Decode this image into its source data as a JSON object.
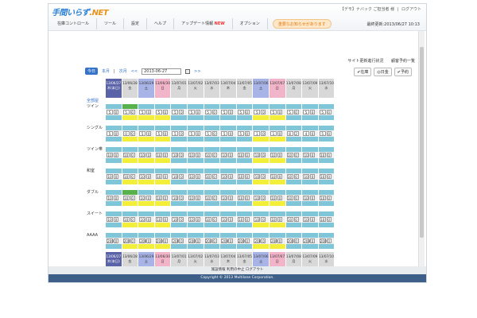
{
  "app": {
    "logo_main": "手間いらず",
    "logo_suffix": ".NET",
    "top_links": [
      "【デモ】ナバック ご担当者 様",
      "|",
      "ログアウト"
    ],
    "menu": [
      "在庫コントロール",
      "ツール",
      "設定",
      "ヘルプ",
      "アップデート情報"
    ],
    "menu_new": "NEW",
    "menu_option": "オプション",
    "menu_info": "重要なお知らせがあります",
    "datetime": "最終更新:2013/06/27 10:13",
    "links": [
      "サイト更新進行状況",
      "顧客予約一覧"
    ]
  },
  "nav": {
    "today_label": "今日",
    "this_month": "本月",
    "next_month": "次月",
    "prev_arrow": "<<",
    "next_arrow": ">>",
    "date_value": "2013-06-27"
  },
  "legend": [
    "✔在庫",
    "◎日金",
    "✔予約"
  ],
  "all_rooms": "全部屋",
  "days": [
    {
      "date": "13/06/27",
      "dow": "木(本日)",
      "type": "today"
    },
    {
      "date": "13/06/28",
      "dow": "金",
      "type": "normal"
    },
    {
      "date": "13/06/29",
      "dow": "土",
      "type": "sat"
    },
    {
      "date": "13/06/30",
      "dow": "日",
      "type": "sun"
    },
    {
      "date": "13/07/01",
      "dow": "月",
      "type": "normal"
    },
    {
      "date": "13/07/02",
      "dow": "火",
      "type": "normal"
    },
    {
      "date": "13/07/03",
      "dow": "水",
      "type": "normal"
    },
    {
      "date": "13/07/04",
      "dow": "木",
      "type": "normal"
    },
    {
      "date": "13/07/05",
      "dow": "金",
      "type": "normal"
    },
    {
      "date": "13/07/06",
      "dow": "土",
      "type": "sat"
    },
    {
      "date": "13/07/07",
      "dow": "日",
      "type": "sun"
    },
    {
      "date": "13/07/08",
      "dow": "月",
      "type": "normal"
    },
    {
      "date": "13/07/09",
      "dow": "火",
      "type": "normal"
    },
    {
      "date": "13/07/10",
      "dow": "水",
      "type": "normal"
    }
  ],
  "rooms": [
    {
      "name": "ツイン",
      "strip": [
        "#7ec6d8",
        "#57b24c",
        "#7ec6d8",
        "#7ec6d8",
        "#7ec6d8",
        "#7ec6d8",
        "#7ec6d8",
        "#7ec6d8",
        "#7ec6d8",
        "#7ec6d8",
        "#7ec6d8",
        "#7ec6d8",
        "#7ec6d8",
        "#7ec6d8"
      ],
      "strip2": [
        "#7ec6d8",
        "#f2ee3a",
        "#f2ee3a",
        "#f2ee3a",
        "#7ec6d8",
        "#7ec6d8",
        "#7ec6d8",
        "#7ec6d8",
        "#7ec6d8",
        "#f2ee3a",
        "#f2ee3a",
        "#7ec6d8",
        "#7ec6d8",
        "#7ec6d8"
      ],
      "counts": [
        [
          "5",
          "0"
        ],
        [
          "5",
          "0"
        ],
        [
          "5",
          "0"
        ],
        [
          "5",
          "0"
        ],
        [
          "5",
          "0"
        ],
        [
          "5",
          "0"
        ],
        [
          "5",
          "0"
        ],
        [
          "5",
          "0"
        ],
        [
          "5",
          "0"
        ],
        [
          "5",
          "0"
        ],
        [
          "5",
          "0"
        ],
        [
          "5",
          "0"
        ],
        [
          "5",
          "0"
        ],
        [
          "5",
          "0"
        ]
      ]
    },
    {
      "name": "シングル",
      "strip": [
        "#7ec6d8",
        "#7ec6d8",
        "#7ec6d8",
        "#7ec6d8",
        "#7ec6d8",
        "#7ec6d8",
        "#7ec6d8",
        "#7ec6d8",
        "#7ec6d8",
        "#7ec6d8",
        "#7ec6d8",
        "#7ec6d8",
        "#7ec6d8",
        "#7ec6d8"
      ],
      "strip2": [
        "#7ec6d8",
        "#f2ee3a",
        "#f2ee3a",
        "#f2ee3a",
        "#7ec6d8",
        "#7ec6d8",
        "#7ec6d8",
        "#7ec6d8",
        "#7ec6d8",
        "#f2ee3a",
        "#f2ee3a",
        "#7ec6d8",
        "#7ec6d8",
        "#7ec6d8"
      ],
      "counts": [
        [
          "5",
          "0"
        ],
        [
          "0",
          "0"
        ],
        [
          "5",
          "0"
        ],
        [
          "5",
          "0"
        ],
        [
          "5",
          "0"
        ],
        [
          "5",
          "0"
        ],
        [
          "5",
          "0"
        ],
        [
          "5",
          "0"
        ],
        [
          "5",
          "0"
        ],
        [
          "1",
          "0"
        ],
        [
          "1",
          "0"
        ],
        [
          "8",
          "2"
        ],
        [
          "4",
          "0"
        ],
        [
          "5",
          "0"
        ]
      ]
    },
    {
      "name": "ツイン帯",
      "strip": [
        "#7ec6d8",
        "#7ec6d8",
        "#7ec6d8",
        "#7ec6d8",
        "#7ec6d8",
        "#7ec6d8",
        "#7ec6d8",
        "#7ec6d8",
        "#7ec6d8",
        "#7ec6d8",
        "#7ec6d8",
        "#7ec6d8",
        "#7ec6d8",
        "#7ec6d8"
      ],
      "strip2": [
        "#7ec6d8",
        "#f2ee3a",
        "#f2ee3a",
        "#f2ee3a",
        "#7ec6d8",
        "#7ec6d8",
        "#7ec6d8",
        "#7ec6d8",
        "#7ec6d8",
        "#f2ee3a",
        "#f2ee3a",
        "#7ec6d8",
        "#7ec6d8",
        "#7ec6d8"
      ],
      "counts": [
        [
          "10",
          "0"
        ],
        [
          "10",
          "0"
        ],
        [
          "10",
          "0"
        ],
        [
          "10",
          "0"
        ],
        [
          "10",
          "0"
        ],
        [
          "10",
          "0"
        ],
        [
          "10",
          "0"
        ],
        [
          "10",
          "0"
        ],
        [
          "10",
          "0"
        ],
        [
          "10",
          "0"
        ],
        [
          "10",
          "0"
        ],
        [
          "10",
          "0"
        ],
        [
          "10",
          "0"
        ],
        [
          "10",
          "0"
        ]
      ]
    },
    {
      "name": "和室",
      "strip": [
        "#7ec6d8",
        "#7ec6d8",
        "#7ec6d8",
        "#7ec6d8",
        "#7ec6d8",
        "#7ec6d8",
        "#7ec6d8",
        "#7ec6d8",
        "#7ec6d8",
        "#7ec6d8",
        "#7ec6d8",
        "#7ec6d8",
        "#7ec6d8",
        "#7ec6d8"
      ],
      "strip2": [
        "#7ec6d8",
        "#f2ee3a",
        "#f2ee3a",
        "#f2ee3a",
        "#7ec6d8",
        "#7ec6d8",
        "#7ec6d8",
        "#7ec6d8",
        "#7ec6d8",
        "#f2ee3a",
        "#f2ee3a",
        "#7ec6d8",
        "#7ec6d8",
        "#7ec6d8"
      ],
      "counts": [
        [
          "10",
          "0"
        ],
        [
          "10",
          "0"
        ],
        [
          "10",
          "0"
        ],
        [
          "10",
          "0"
        ],
        [
          "10",
          "0"
        ],
        [
          "10",
          "0"
        ],
        [
          "10",
          "0"
        ],
        [
          "10",
          "0"
        ],
        [
          "10",
          "0"
        ],
        [
          "10",
          "0"
        ],
        [
          "10",
          "0"
        ],
        [
          "10",
          "0"
        ],
        [
          "10",
          "0"
        ],
        [
          "10",
          "0"
        ]
      ]
    },
    {
      "name": "ダブル",
      "strip": [
        "#7ec6d8",
        "#57b24c",
        "#7ec6d8",
        "#7ec6d8",
        "#7ec6d8",
        "#7ec6d8",
        "#7ec6d8",
        "#7ec6d8",
        "#7ec6d8",
        "#7ec6d8",
        "#7ec6d8",
        "#7ec6d8",
        "#7ec6d8",
        "#7ec6d8"
      ],
      "strip2": [
        "#7ec6d8",
        "#f2ee3a",
        "#f2ee3a",
        "#f2ee3a",
        "#7ec6d8",
        "#7ec6d8",
        "#7ec6d8",
        "#7ec6d8",
        "#7ec6d8",
        "#f2ee3a",
        "#f2ee3a",
        "#7ec6d8",
        "#7ec6d8",
        "#7ec6d8"
      ],
      "counts": [
        [
          "10",
          "0"
        ],
        [
          "10",
          "0"
        ],
        [
          "10",
          "0"
        ],
        [
          "10",
          "0"
        ],
        [
          "10",
          "0"
        ],
        [
          "10",
          "0"
        ],
        [
          "10",
          "0"
        ],
        [
          "10",
          "0"
        ],
        [
          "10",
          "0"
        ],
        [
          "10",
          "0"
        ],
        [
          "10",
          "0"
        ],
        [
          "10",
          "0"
        ],
        [
          "10",
          "0"
        ],
        [
          "10",
          "0"
        ]
      ]
    },
    {
      "name": "スイート",
      "strip": [
        "#7ec6d8",
        "#7ec6d8",
        "#7ec6d8",
        "#7ec6d8",
        "#7ec6d8",
        "#7ec6d8",
        "#7ec6d8",
        "#7ec6d8",
        "#7ec6d8",
        "#7ec6d8",
        "#7ec6d8",
        "#7ec6d8",
        "#7ec6d8",
        "#7ec6d8"
      ],
      "strip2": [
        "#7ec6d8",
        "#f2ee3a",
        "#f2ee3a",
        "#f2ee3a",
        "#7ec6d8",
        "#7ec6d8",
        "#7ec6d8",
        "#7ec6d8",
        "#7ec6d8",
        "#f2ee3a",
        "#f2ee3a",
        "#7ec6d8",
        "#7ec6d8",
        "#7ec6d8"
      ],
      "counts": [
        [
          "10",
          "0"
        ],
        [
          "10",
          "0"
        ],
        [
          "10",
          "0"
        ],
        [
          "10",
          "0"
        ],
        [
          "10",
          "0"
        ],
        [
          "10",
          "0"
        ],
        [
          "10",
          "0"
        ],
        [
          "10",
          "0"
        ],
        [
          "10",
          "0"
        ],
        [
          "10",
          "0"
        ],
        [
          "10",
          "0"
        ],
        [
          "10",
          "0"
        ],
        [
          "10",
          "0"
        ],
        [
          "10",
          "0"
        ]
      ]
    },
    {
      "name": "AAAA",
      "strip": [
        "#7ec6d8",
        "#7ec6d8",
        "#7ec6d8",
        "#7ec6d8",
        "#7ec6d8",
        "#7ec6d8",
        "#7ec6d8",
        "#7ec6d8",
        "#7ec6d8",
        "#7ec6d8",
        "#7ec6d8",
        "#7ec6d8",
        "#7ec6d8",
        "#7ec6d8"
      ],
      "strip2": [
        "#7ec6d8",
        "#f2ee3a",
        "#f2ee3a",
        "#f2ee3a",
        "#7ec6d8",
        "#7ec6d8",
        "#7ec6d8",
        "#7ec6d8",
        "#7ec6d8",
        "#f2ee3a",
        "#f2ee3a",
        "#7ec6d8",
        "#7ec6d8",
        "#7ec6d8"
      ],
      "counts": [
        [
          "200",
          "0"
        ],
        [
          "200",
          "0"
        ],
        [
          "200",
          "0"
        ],
        [
          "200",
          "0"
        ],
        [
          "200",
          "0"
        ],
        [
          "200",
          "0"
        ],
        [
          "200",
          "0"
        ],
        [
          "200",
          "0"
        ],
        [
          "200",
          "0"
        ],
        [
          "200",
          "0"
        ],
        [
          "200",
          "0"
        ],
        [
          "200",
          "0"
        ],
        [
          "200",
          "0"
        ],
        [
          "200",
          "0"
        ]
      ]
    }
  ],
  "bottom_bar": "施設情報 利用の中止 ログアウト",
  "copyright": "Copyright © 2013 Multilane Corporation."
}
